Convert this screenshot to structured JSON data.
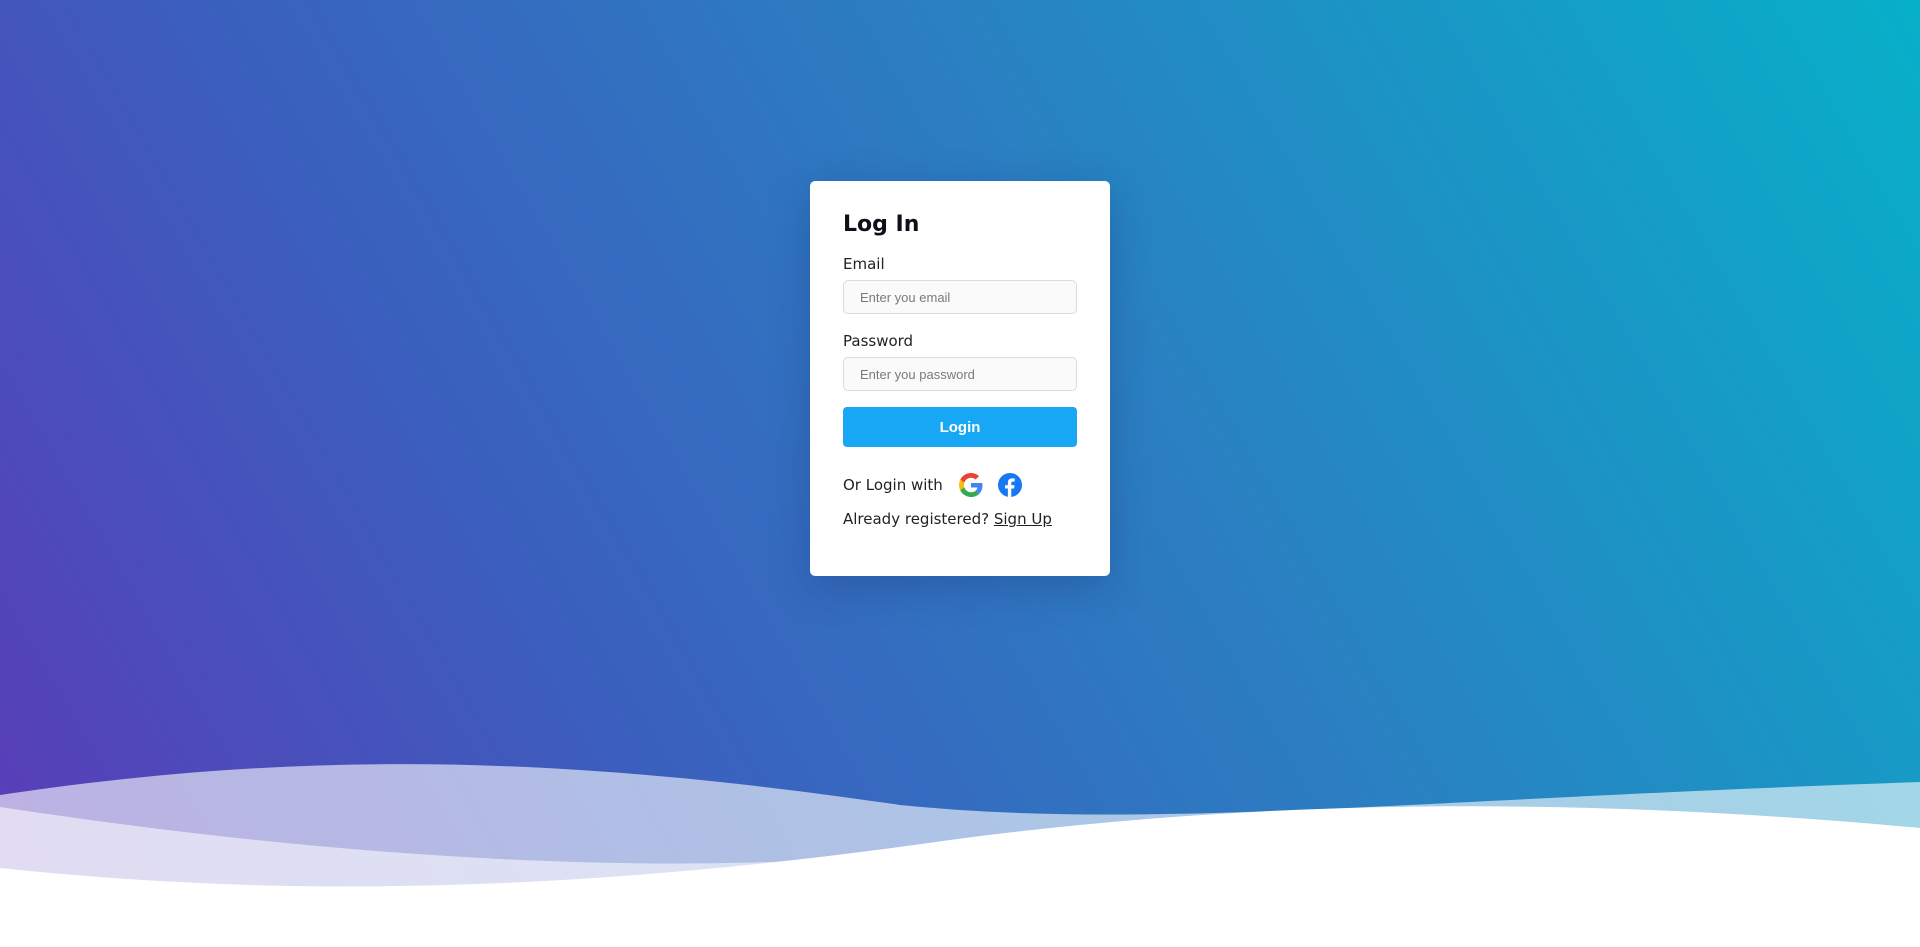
{
  "login": {
    "title": "Log In",
    "email_label": "Email",
    "email_placeholder": "Enter you email",
    "email_value": "",
    "password_label": "Password",
    "password_placeholder": "Enter you password",
    "password_value": "",
    "submit_label": "Login",
    "social_text": "Or Login with",
    "social_icons": [
      "google-icon",
      "facebook-icon"
    ],
    "registered_text": "Already registered? ",
    "signup_label": "Sign Up"
  },
  "colors": {
    "gradient_start": "#5b3bb8",
    "gradient_end": "#07b0c9",
    "button": "#17a7f4",
    "card": "#ffffff",
    "facebook": "#1877f2"
  }
}
